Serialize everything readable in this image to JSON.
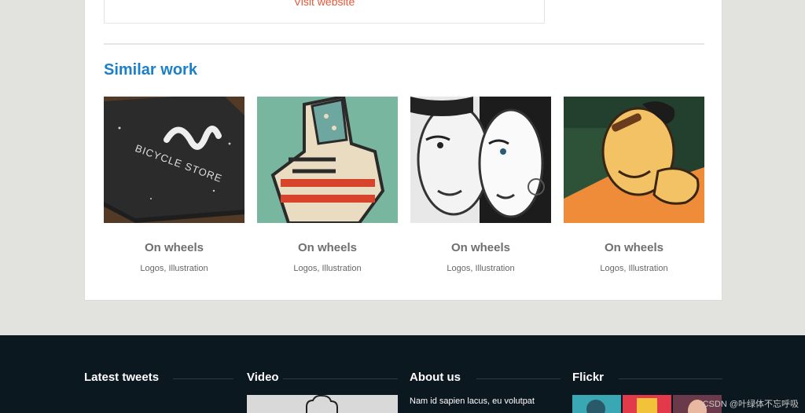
{
  "visit": {
    "label": "Visit website"
  },
  "similar": {
    "title": "Similar work",
    "items": [
      {
        "title": "On wheels",
        "tags": "Logos, Illustration",
        "image": "bicycle-store-card"
      },
      {
        "title": "On wheels",
        "tags": "Logos, Illustration",
        "image": "flag-fist-illustration"
      },
      {
        "title": "On wheels",
        "tags": "Logos, Illustration",
        "image": "couple-sketch-illustration"
      },
      {
        "title": "On wheels",
        "tags": "Logos, Illustration",
        "image": "cigar-man-illustration"
      }
    ]
  },
  "footer": {
    "tweets_title": "Latest tweets",
    "video_title": "Video",
    "about_title": "About us",
    "about_text": "Nam id sapien lacus, eu volutpat",
    "flickr_title": "Flickr"
  },
  "watermark": "CSDN @叶绿体不忘呼吸",
  "colors": {
    "accent": "#1c7fc7",
    "link": "#e8583a",
    "footer_bg": "#0c1820"
  }
}
